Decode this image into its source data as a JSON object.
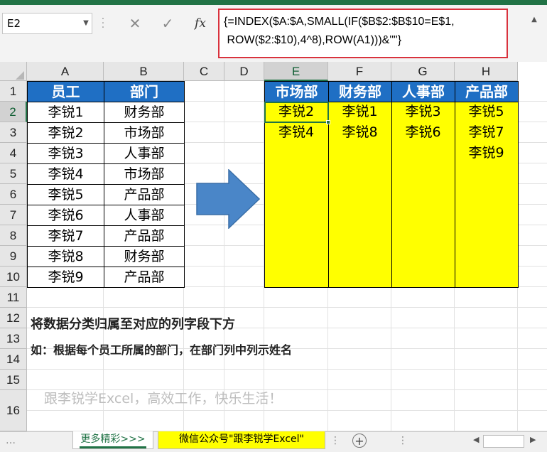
{
  "formula_bar": {
    "name_box": "E2",
    "cancel_icon": "✕",
    "enter_icon": "✓",
    "fx_label": "fx",
    "formula": "{=INDEX($A:$A,SMALL(IF($B$2:$B$10=E$1,\n ROW($2:$10),4^8),ROW(A1)))&\"\"}"
  },
  "columns": [
    "A",
    "B",
    "C",
    "D",
    "E",
    "F",
    "G",
    "H"
  ],
  "rows": [
    "1",
    "2",
    "3",
    "4",
    "5",
    "6",
    "7",
    "8",
    "9",
    "10",
    "11",
    "12",
    "13",
    "14",
    "15",
    "16"
  ],
  "source_table": {
    "headers": [
      "员工",
      "部门"
    ],
    "rows": [
      [
        "李锐1",
        "财务部"
      ],
      [
        "李锐2",
        "市场部"
      ],
      [
        "李锐3",
        "人事部"
      ],
      [
        "李锐4",
        "市场部"
      ],
      [
        "李锐5",
        "产品部"
      ],
      [
        "李锐6",
        "人事部"
      ],
      [
        "李锐7",
        "产品部"
      ],
      [
        "李锐8",
        "财务部"
      ],
      [
        "李锐9",
        "产品部"
      ]
    ]
  },
  "result_table": {
    "headers": [
      "市场部",
      "财务部",
      "人事部",
      "产品部"
    ],
    "columns": [
      [
        "李锐2",
        "李锐4"
      ],
      [
        "李锐1",
        "李锐8"
      ],
      [
        "李锐3",
        "李锐6"
      ],
      [
        "李锐5",
        "李锐7",
        "李锐9"
      ]
    ]
  },
  "notes": {
    "line1": "将数据分类归属至对应的列字段下方",
    "line2": "如：根据每个员工所属的部门，在部门列中列示姓名",
    "line3": "跟李锐学Excel，高效工作，快乐生活！"
  },
  "sheet_tabs": {
    "tab1": "更多精彩>>>",
    "tab2": "微信公众号\"跟李锐学Excel\"",
    "add": "+"
  },
  "colors": {
    "header_blue": "#1f6fc4",
    "highlight_yellow": "#ffff00",
    "excel_green": "#217346",
    "formula_border_red": "#d9323d",
    "arrow_blue": "#4a86c8"
  }
}
